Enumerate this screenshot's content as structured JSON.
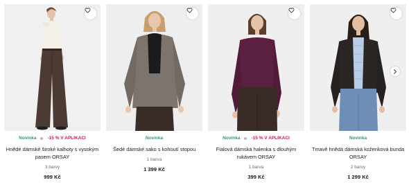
{
  "products": [
    {
      "badge_new": "Novinka",
      "badge_sale": "-15 % V APLIKACI",
      "name": "Hnědé dámské široké kalhoty s vysokým pasem ORSAY",
      "colors": "3 barvy",
      "price": "999 Kč",
      "photo_icon": "woman-wide-trousers-photo"
    },
    {
      "badge_new": "Novinka",
      "name": "Šedé dámské sako s kohoutí stopou ORSAY",
      "colors": "1 barva",
      "price": "1 399 Kč",
      "photo_icon": "woman-houndstooth-blazer-photo"
    },
    {
      "badge_new": "Novinka",
      "badge_sale": "-15 % V APLIKACI",
      "name": "Fialová dámská halenka s dlouhým rukávem ORSAY",
      "colors": "1 barva",
      "price": "399 Kč",
      "photo_icon": "woman-purple-blouse-photo"
    },
    {
      "badge_new": "Novinka",
      "name": "Tmavě hnědá dámská koženková bunda ORSAY",
      "colors": "2 barvy",
      "price": "1 299 Kč",
      "photo_icon": "woman-leather-jacket-photo"
    }
  ],
  "icons": {
    "wishlist": "heart-icon",
    "next": "chevron-right-icon"
  },
  "colors": {
    "new_badge": "#3f8f6e",
    "sale_badge": "#c2185b"
  }
}
